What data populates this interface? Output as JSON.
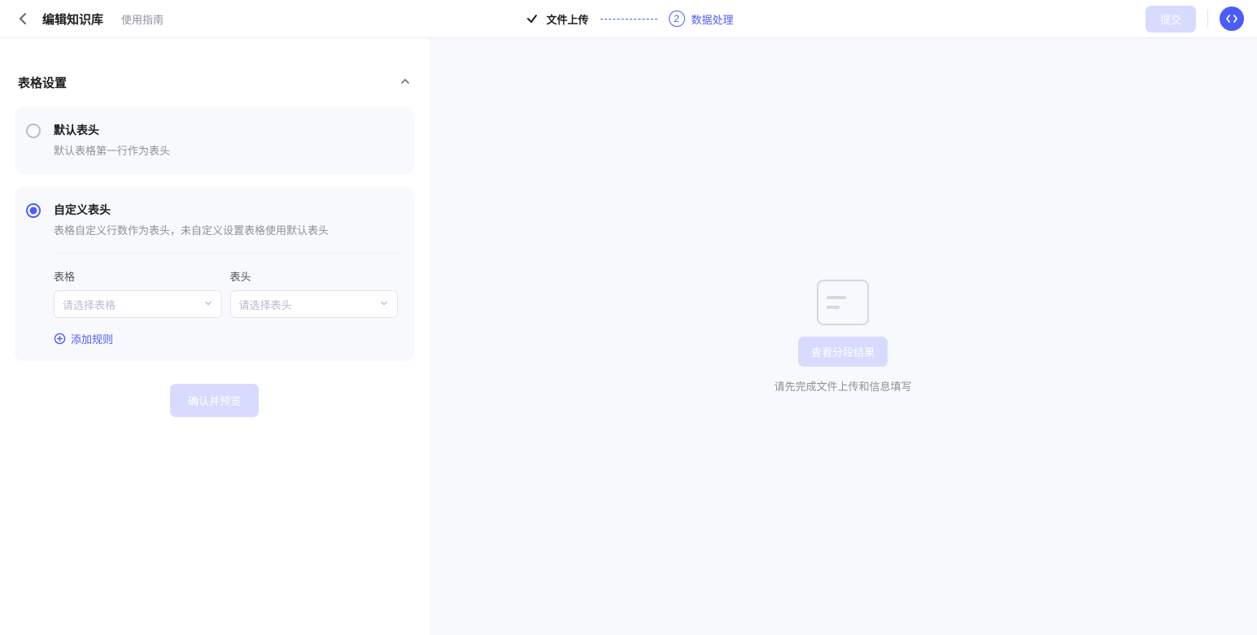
{
  "header": {
    "page_title": "编辑知识库",
    "guide_link": "使用指南",
    "submit_label": "提交",
    "steps": {
      "step1_label": "文件上传",
      "step2_num": "2",
      "step2_label": "数据处理"
    }
  },
  "left": {
    "section_title": "表格设置",
    "option1": {
      "title": "默认表头",
      "desc": "默认表格第一行作为表头"
    },
    "option2": {
      "title": "自定义表头",
      "desc": "表格自定义行数作为表头，未自定义设置表格使用默认表头"
    },
    "form": {
      "table_label": "表格",
      "header_label": "表头",
      "table_placeholder": "请选择表格",
      "header_placeholder": "请选择表头",
      "add_rule_label": "添加规则"
    },
    "confirm_label": "确认并预览"
  },
  "right": {
    "view_result_label": "查看分段结果",
    "hint": "请先完成文件上传和信息填写"
  }
}
